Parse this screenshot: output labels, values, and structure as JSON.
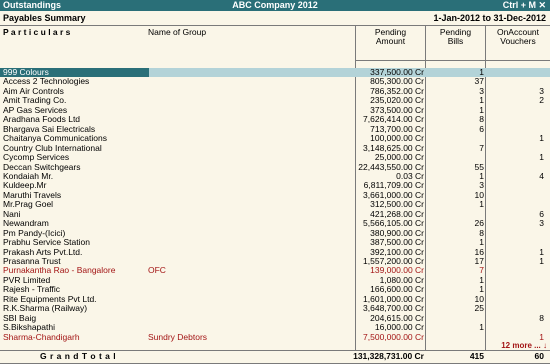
{
  "titlebar": {
    "left": "Outstandings",
    "center": "ABC Company 2012",
    "right": "Ctrl + M  ✕"
  },
  "header": {
    "title": "Payables Summary",
    "period": "1-Jan-2012 to 31-Dec-2012"
  },
  "columns": {
    "particulars": "P a r t i c u l a r s",
    "group": "Name of Group",
    "amount": [
      "Pending",
      "Amount"
    ],
    "bills": [
      "Pending",
      "Bills"
    ],
    "vouchers": [
      "OnAccount",
      "Vouchers"
    ]
  },
  "rows": [
    {
      "particulars": "999 Colours",
      "group": "",
      "amount": "337,500.00 Cr",
      "bills": "1",
      "vouchers": "",
      "selected": true,
      "red": false
    },
    {
      "particulars": "Access 2 Technologies",
      "group": "",
      "amount": "805,300.00 Cr",
      "bills": "37",
      "vouchers": "",
      "selected": false,
      "red": false
    },
    {
      "particulars": "Aim Air Controls",
      "group": "",
      "amount": "786,352.00 Cr",
      "bills": "3",
      "vouchers": "3",
      "selected": false,
      "red": false
    },
    {
      "particulars": "Amit Trading Co.",
      "group": "",
      "amount": "235,020.00 Cr",
      "bills": "1",
      "vouchers": "2",
      "selected": false,
      "red": false
    },
    {
      "particulars": "AP Gas Services",
      "group": "",
      "amount": "373,500.00 Cr",
      "bills": "1",
      "vouchers": "",
      "selected": false,
      "red": false
    },
    {
      "particulars": "Aradhana Foods Ltd",
      "group": "",
      "amount": "7,626,414.00 Cr",
      "bills": "8",
      "vouchers": "",
      "selected": false,
      "red": false
    },
    {
      "particulars": "Bhargava Sai Electricals",
      "group": "",
      "amount": "713,700.00 Cr",
      "bills": "6",
      "vouchers": "",
      "selected": false,
      "red": false
    },
    {
      "particulars": "Chaitanya Communications",
      "group": "",
      "amount": "100,000.00 Cr",
      "bills": "",
      "vouchers": "1",
      "selected": false,
      "red": false
    },
    {
      "particulars": "Country Club International",
      "group": "",
      "amount": "3,148,625.00 Cr",
      "bills": "7",
      "vouchers": "",
      "selected": false,
      "red": false
    },
    {
      "particulars": "Cycomp Services",
      "group": "",
      "amount": "25,000.00 Cr",
      "bills": "",
      "vouchers": "1",
      "selected": false,
      "red": false
    },
    {
      "particulars": "Deccan Switchgears",
      "group": "",
      "amount": "22,443,550.00 Cr",
      "bills": "55",
      "vouchers": "",
      "selected": false,
      "red": false
    },
    {
      "particulars": "Kondaiah Mr.",
      "group": "",
      "amount": "0.03 Cr",
      "bills": "1",
      "vouchers": "4",
      "selected": false,
      "red": false
    },
    {
      "particulars": "Kuldeep.Mr",
      "group": "",
      "amount": "6,811,709.00 Cr",
      "bills": "3",
      "vouchers": "",
      "selected": false,
      "red": false
    },
    {
      "particulars": "Maruthi Travels",
      "group": "",
      "amount": "3,661,000.00 Cr",
      "bills": "10",
      "vouchers": "",
      "selected": false,
      "red": false
    },
    {
      "particulars": "Mr.Prag Goel",
      "group": "",
      "amount": "312,500.00 Cr",
      "bills": "1",
      "vouchers": "",
      "selected": false,
      "red": false
    },
    {
      "particulars": "Nani",
      "group": "",
      "amount": "421,268.00 Cr",
      "bills": "",
      "vouchers": "6",
      "selected": false,
      "red": false
    },
    {
      "particulars": "Newandram",
      "group": "",
      "amount": "5,566,105.00 Cr",
      "bills": "26",
      "vouchers": "3",
      "selected": false,
      "red": false
    },
    {
      "particulars": "Pm Pandy-(Icici)",
      "group": "",
      "amount": "380,900.00 Cr",
      "bills": "8",
      "vouchers": "",
      "selected": false,
      "red": false
    },
    {
      "particulars": "Prabhu Service Station",
      "group": "",
      "amount": "387,500.00 Cr",
      "bills": "1",
      "vouchers": "",
      "selected": false,
      "red": false
    },
    {
      "particulars": "Prakash Arts Pvt.Ltd.",
      "group": "",
      "amount": "392,100.00 Cr",
      "bills": "16",
      "vouchers": "1",
      "selected": false,
      "red": false
    },
    {
      "particulars": "Prasanna Trust",
      "group": "",
      "amount": "1,557,200.00 Cr",
      "bills": "17",
      "vouchers": "1",
      "selected": false,
      "red": false
    },
    {
      "particulars": "Purnakantha Rao - Bangalore",
      "group": "OFC",
      "amount": "139,000.00 Cr",
      "bills": "7",
      "vouchers": "",
      "selected": false,
      "red": true
    },
    {
      "particulars": "PVR Limited",
      "group": "",
      "amount": "1,080.00 Cr",
      "bills": "1",
      "vouchers": "",
      "selected": false,
      "red": false
    },
    {
      "particulars": "Rajesh - Traffic",
      "group": "",
      "amount": "166,600.00 Cr",
      "bills": "1",
      "vouchers": "",
      "selected": false,
      "red": false
    },
    {
      "particulars": "Rite Equipments Pvt Ltd.",
      "group": "",
      "amount": "1,601,000.00 Cr",
      "bills": "10",
      "vouchers": "",
      "selected": false,
      "red": false
    },
    {
      "particulars": "R.K.Sharma (Railway)",
      "group": "",
      "amount": "3,648,700.00 Cr",
      "bills": "25",
      "vouchers": "",
      "selected": false,
      "red": false
    },
    {
      "particulars": "SBI Baig",
      "group": "",
      "amount": "204,615.00 Cr",
      "bills": "",
      "vouchers": "8",
      "selected": false,
      "red": false
    },
    {
      "particulars": "S.Bikshapathi",
      "group": "",
      "amount": "16,000.00 Cr",
      "bills": "1",
      "vouchers": "",
      "selected": false,
      "red": false
    },
    {
      "particulars": "Sharma-Chandigarh",
      "group": "Sundry Debtors",
      "amount": "7,500,000.00 Cr",
      "bills": "",
      "vouchers": "1",
      "selected": false,
      "red": true
    }
  ],
  "more": "12 more ... ↓",
  "total": {
    "label": "G r a n d   T o t a l",
    "amount": "131,328,731.00 Cr",
    "bills": "415",
    "vouchers": "60"
  },
  "colors": {
    "titlebar": "#2a6f78",
    "selection": "#b3d3d8",
    "highlight": "#2a6f78",
    "red_text": "#a31515",
    "background": "#faf6e8"
  }
}
